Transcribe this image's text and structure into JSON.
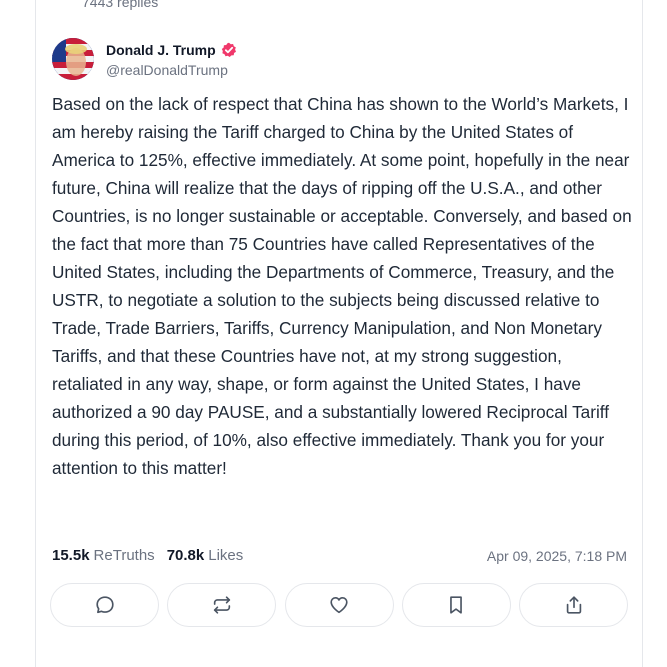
{
  "previous_post": {
    "replies_text": "7443 replies"
  },
  "post": {
    "author": {
      "display_name": "Donald J. Trump",
      "handle": "@realDonaldTrump"
    },
    "body": "Based on the lack of respect that China has shown to the World’s Markets, I am hereby raising the Tariff charged to China by the United States of America to 125%, effective immediately. At some point, hopefully in the near future, China will realize that the days of ripping off the U.S.A., and other Countries, is no longer sustainable or acceptable. Conversely, and based on the fact that more than 75 Countries have called Representatives of the United States, including the Departments of Commerce, Treasury, and the USTR, to negotiate a solution to the subjects being discussed relative to Trade, Trade Barriers, Tariffs, Currency Manipulation, and Non Monetary Tariffs, and that these Countries have not, at my strong suggestion, retaliated in any way, shape, or form against the United States, I have authorized a 90 day PAUSE, and a substantially lowered Reciprocal Tariff during this period, of 10%, also effective immediately. Thank you for your attention to this matter!",
    "stats": {
      "retruths_count": "15.5k",
      "retruths_label": "ReTruths",
      "likes_count": "70.8k",
      "likes_label": "Likes"
    },
    "timestamp": "Apr 09, 2025, 7:18 PM"
  },
  "actions": [
    {
      "name": "reply",
      "icon": "speech-bubble-icon"
    },
    {
      "name": "retruth",
      "icon": "repost-icon"
    },
    {
      "name": "like",
      "icon": "heart-icon"
    },
    {
      "name": "bookmark",
      "icon": "bookmark-icon"
    },
    {
      "name": "share",
      "icon": "share-icon"
    }
  ],
  "colors": {
    "verified_badge": "#f0386b",
    "muted_text": "#6b7280",
    "border": "#e5e7eb"
  }
}
